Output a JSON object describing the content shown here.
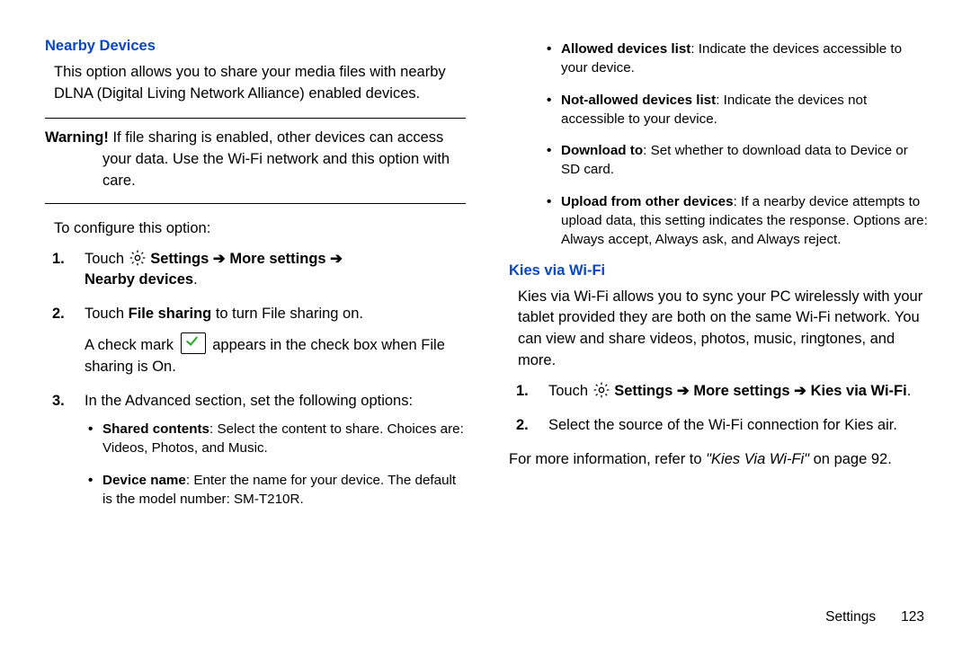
{
  "left": {
    "heading": "Nearby Devices",
    "intro": "This option allows you to share your media files with nearby DLNA (Digital Living Network Alliance) enabled devices.",
    "warning_label": "Warning! ",
    "warning_first": "If file sharing is enabled, other devices can access",
    "warning_rest": "your data. Use the Wi-Fi network and this option with care.",
    "configure": "To configure this option:",
    "step1_a": "Touch ",
    "step1_b": " Settings ",
    "arrow": "➔",
    "step1_c": " More settings ",
    "step1_d": "Nearby devices",
    "step1_e": ".",
    "step2_a": "Touch ",
    "step2_b": "File sharing",
    "step2_c": " to turn File sharing on.",
    "step2_d1": "A check mark ",
    "step2_d2": " appears in the check box when File sharing is On.",
    "step3": "In the Advanced section, set the following options:",
    "b1_t": "Shared contents",
    "b1_b": ": Select the content to share. Choices are: Videos, Photos, and Music.",
    "b2_t": "Device name",
    "b2_b": ": Enter the name for your device. The default is the model number: SM-T210R."
  },
  "right": {
    "b3_t": "Allowed devices list",
    "b3_b": ": Indicate the devices accessible to your device.",
    "b4_t": "Not-allowed devices list",
    "b4_b": ": Indicate the devices not accessible to your device.",
    "b5_t": "Download to",
    "b5_b": ": Set whether to download data to Device or SD card.",
    "b6_t": "Upload from other devices",
    "b6_b": ": If a nearby device attempts to upload data, this setting indicates the response. Options are: Always accept, Always ask, and Always reject.",
    "heading2": "Kies via Wi-Fi",
    "kies_intro": "Kies via Wi-Fi allows you to sync your PC wirelessly with your tablet provided they are both on the same Wi-Fi network. You can view and share videos, photos, music, ringtones, and more.",
    "kies_step1_a": "Touch ",
    "kies_step1_b": " Settings ",
    "kies_step1_c": " More settings ",
    "kies_step1_d": " Kies via Wi-Fi",
    "kies_step1_e": ".",
    "kies_step2": "Select the source of the Wi-Fi connection for Kies air.",
    "more_a": "For more information, refer to ",
    "more_b": "\"Kies Via Wi-Fi\"",
    "more_c": " on page 92."
  },
  "footer": {
    "section": "Settings",
    "page": "123"
  },
  "num": {
    "n1": "1.",
    "n2": "2.",
    "n3": "3."
  }
}
